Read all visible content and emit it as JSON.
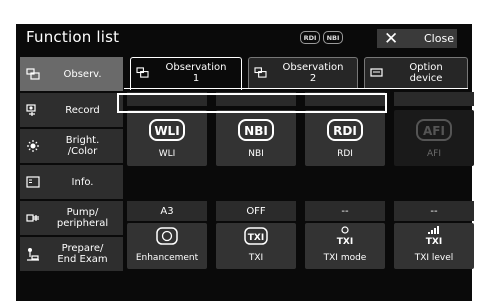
{
  "header": {
    "title": "Function list",
    "badges": [
      "RDI",
      "NBI"
    ],
    "close_label": "Close"
  },
  "sidebar": {
    "items": [
      {
        "label": "Observ.",
        "icon": "observation-icon",
        "active": true
      },
      {
        "label": "Record",
        "icon": "record-icon"
      },
      {
        "label": "Bright.\n/Color",
        "icon": "brightness-icon"
      },
      {
        "label": "Info.",
        "icon": "info-icon"
      },
      {
        "label": "Pump/\nperipheral",
        "icon": "pump-icon"
      },
      {
        "label": "Prepare/\nEnd Exam",
        "icon": "prepare-icon"
      }
    ]
  },
  "tabs": [
    {
      "label": "Observation\n1",
      "active": true
    },
    {
      "label": "Observation\n2"
    },
    {
      "label": "Option\ndevice"
    }
  ],
  "modes": [
    {
      "icon_text": "WLI",
      "label": "WLI"
    },
    {
      "icon_text": "NBI",
      "label": "NBI"
    },
    {
      "icon_text": "RDI",
      "label": "RDI"
    },
    {
      "icon_text": "AFI",
      "label": "AFI",
      "disabled": true
    }
  ],
  "values": [
    "A3",
    "OFF",
    "--",
    "--"
  ],
  "functions": [
    {
      "label": "Enhancement",
      "icon": "enhancement-icon"
    },
    {
      "label": "TXI",
      "icon": "txi-icon"
    },
    {
      "label": "TXI mode",
      "icon": "txi-mode-icon",
      "icon_text": "TXI"
    },
    {
      "label": "TXI level",
      "icon": "txi-level-icon",
      "icon_text": "TXI"
    }
  ]
}
